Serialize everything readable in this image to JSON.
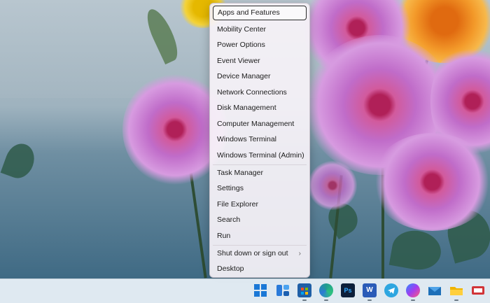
{
  "menu": {
    "items": [
      {
        "label": "Apps and Features"
      },
      {
        "label": "Mobility Center"
      },
      {
        "label": "Power Options"
      },
      {
        "label": "Event Viewer"
      },
      {
        "label": "Device Manager"
      },
      {
        "label": "Network Connections"
      },
      {
        "label": "Disk Management"
      },
      {
        "label": "Computer Management"
      },
      {
        "label": "Windows Terminal"
      },
      {
        "label": "Windows Terminal (Admin)"
      },
      {
        "label": "Task Manager"
      },
      {
        "label": "Settings"
      },
      {
        "label": "File Explorer"
      },
      {
        "label": "Search"
      },
      {
        "label": "Run"
      },
      {
        "label": "Shut down or sign out"
      },
      {
        "label": "Desktop"
      }
    ],
    "submenu_glyph": "›"
  },
  "taskbar": {
    "icons": [
      {
        "name": "start-icon",
        "color": "#1b78d6"
      },
      {
        "name": "widgets-icon",
        "color": "#2a7ad9"
      },
      {
        "name": "store-icon",
        "color": "#1f5fa6"
      },
      {
        "name": "edge-icon",
        "color": "#1f9c8f"
      },
      {
        "name": "photoshop-icon",
        "color": "#0c1f3a",
        "text": "Ps"
      },
      {
        "name": "word-icon",
        "color": "#2a5bb8",
        "text": "W"
      },
      {
        "name": "telegram-icon",
        "color": "#2ea6e0"
      },
      {
        "name": "messenger-icon",
        "color": "#8f4cf0"
      },
      {
        "name": "mail-icon",
        "color": "#1d6fb8"
      },
      {
        "name": "file-explorer-icon",
        "color": "#f0b400"
      },
      {
        "name": "presentation-icon",
        "color": "#d13438"
      }
    ]
  }
}
